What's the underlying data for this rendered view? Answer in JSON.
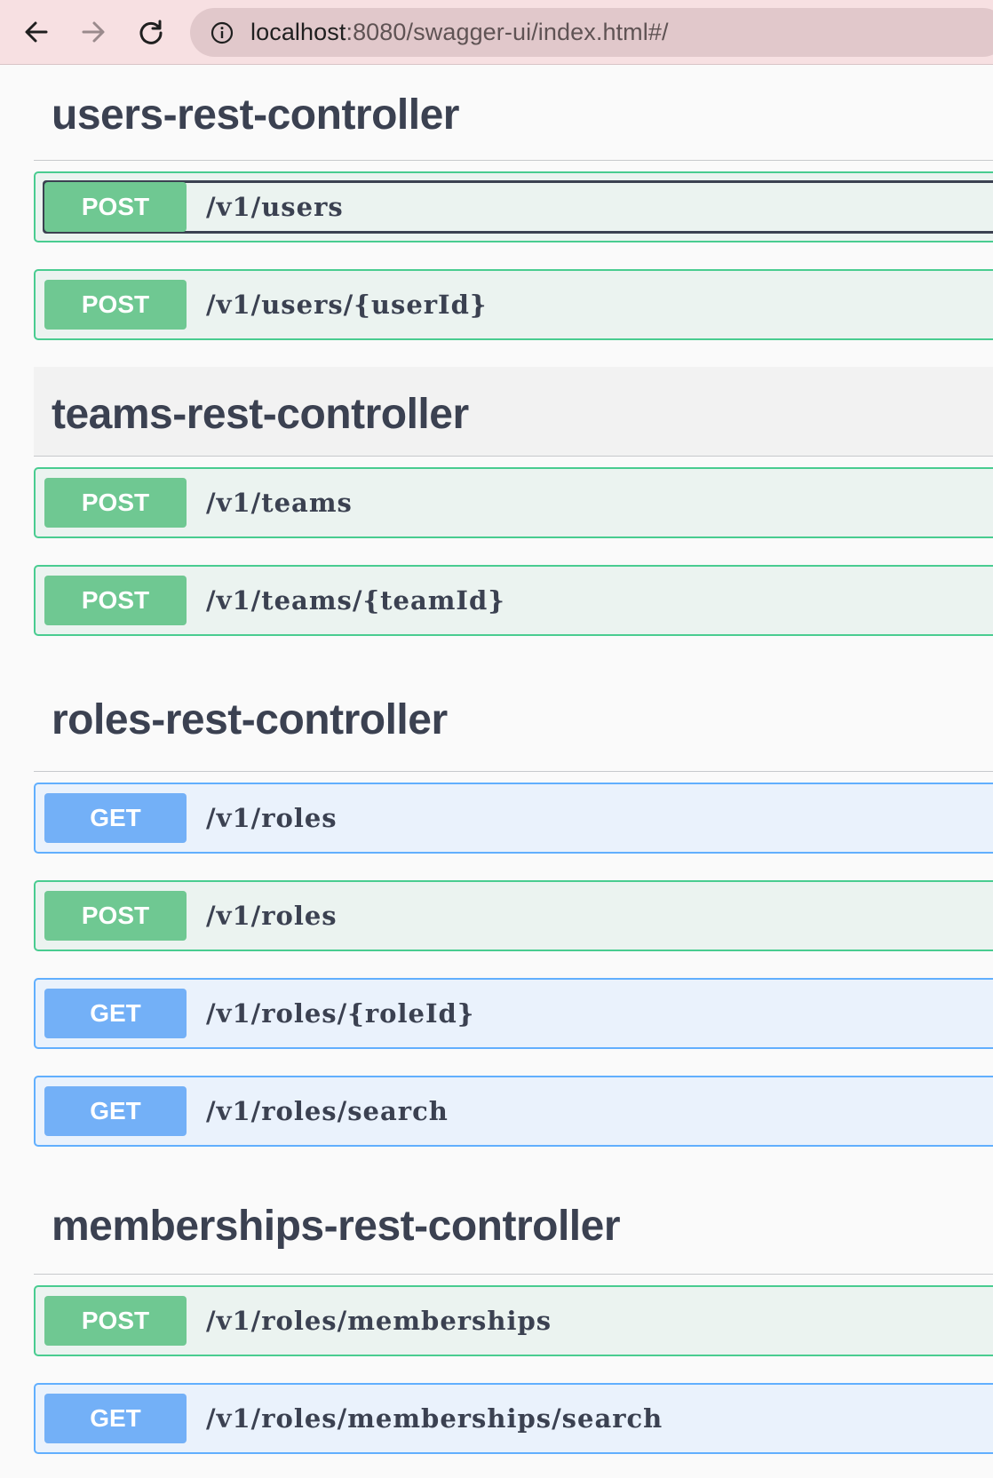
{
  "browser": {
    "url_host": "localhost",
    "url_rest": ":8080/swagger-ui/index.html#/"
  },
  "colors": {
    "post": "#49cc90",
    "get": "#61affe",
    "text": "#3b4151"
  },
  "sections": [
    {
      "title": "users-rest-controller",
      "operations": [
        {
          "method": "POST",
          "path": "/v1/users"
        },
        {
          "method": "POST",
          "path": "/v1/users/{userId}"
        }
      ]
    },
    {
      "title": "teams-rest-controller",
      "operations": [
        {
          "method": "POST",
          "path": "/v1/teams"
        },
        {
          "method": "POST",
          "path": "/v1/teams/{teamId}"
        }
      ]
    },
    {
      "title": "roles-rest-controller",
      "operations": [
        {
          "method": "GET",
          "path": "/v1/roles"
        },
        {
          "method": "POST",
          "path": "/v1/roles"
        },
        {
          "method": "GET",
          "path": "/v1/roles/{roleId}"
        },
        {
          "method": "GET",
          "path": "/v1/roles/search"
        }
      ]
    },
    {
      "title": "memberships-rest-controller",
      "operations": [
        {
          "method": "POST",
          "path": "/v1/roles/memberships"
        },
        {
          "method": "GET",
          "path": "/v1/roles/memberships/search"
        }
      ]
    }
  ]
}
